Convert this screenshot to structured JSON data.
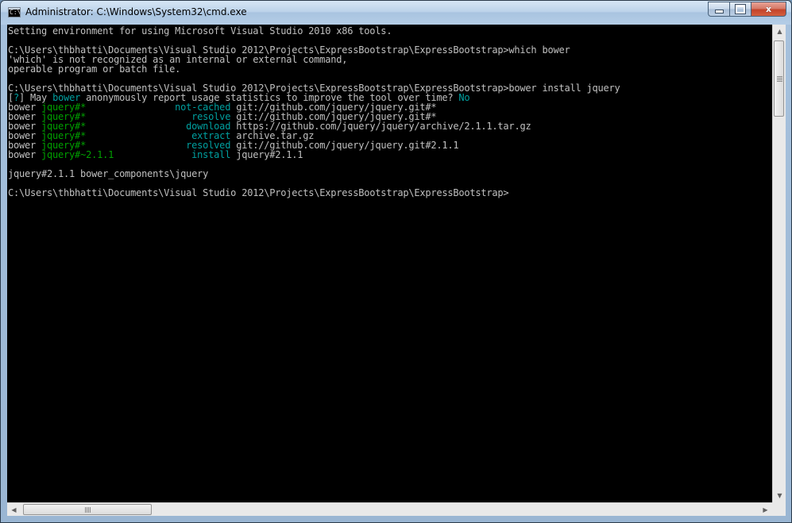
{
  "window": {
    "title": "Administrator: C:\\Windows\\System32\\cmd.exe",
    "icon": "cmd-console-icon",
    "icon_text": "C:\\"
  },
  "controls": {
    "minimize_icon": "minimize-icon",
    "maximize_icon": "maximize-icon",
    "close_icon": "close-icon",
    "close_glyph": "x"
  },
  "colors": {
    "console_bg": "#000000",
    "console_text": "#c0c0c0",
    "green": "#00a000",
    "cyan": "#00a0a0"
  },
  "console": {
    "line1": "Setting environment for using Microsoft Visual Studio 2010 x86 tools.",
    "cmd1": "C:\\Users\\thbhatti\\Documents\\Visual Studio 2012\\Projects\\ExpressBootstrap\\ExpressBootstrap>which bower",
    "err1": "'which' is not recognized as an internal or external command,",
    "err2": "operable program or batch file.",
    "cmd2": "C:\\Users\\thbhatti\\Documents\\Visual Studio 2012\\Projects\\ExpressBootstrap\\ExpressBootstrap>bower install jquery",
    "prompt": {
      "open": "[",
      "q": "?",
      "mid1": "] May ",
      "bower": "bower",
      "mid2": " anonymously report usage statistics to improve the tool over time? ",
      "answer": "No"
    },
    "bower_lines": [
      {
        "prefix": "bower ",
        "pkg": "jquery#*              ",
        "action": "  not-cached",
        "detail": " git://github.com/jquery/jquery.git#*"
      },
      {
        "prefix": "bower ",
        "pkg": "jquery#*              ",
        "action": "     resolve",
        "detail": " git://github.com/jquery/jquery.git#*"
      },
      {
        "prefix": "bower ",
        "pkg": "jquery#*              ",
        "action": "    download",
        "detail": " https://github.com/jquery/jquery/archive/2.1.1.tar.gz"
      },
      {
        "prefix": "bower ",
        "pkg": "jquery#*              ",
        "action": "     extract",
        "detail": " archive.tar.gz"
      },
      {
        "prefix": "bower ",
        "pkg": "jquery#*              ",
        "action": "    resolved",
        "detail": " git://github.com/jquery/jquery.git#2.1.1"
      },
      {
        "prefix": "bower ",
        "pkg": "jquery#~2.1.1         ",
        "action": "     install",
        "detail": " jquery#2.1.1"
      }
    ],
    "result": "jquery#2.1.1 bower_components\\jquery",
    "cmd3": "C:\\Users\\thbhatti\\Documents\\Visual Studio 2012\\Projects\\ExpressBootstrap\\ExpressBootstrap>"
  },
  "scrollbars": {
    "up_icon": "arrow-up-icon",
    "down_icon": "arrow-down-icon",
    "left_icon": "arrow-left-icon",
    "right_icon": "arrow-right-icon",
    "up_glyph": "▲",
    "down_glyph": "▼",
    "left_glyph": "◀",
    "right_glyph": "▶"
  }
}
